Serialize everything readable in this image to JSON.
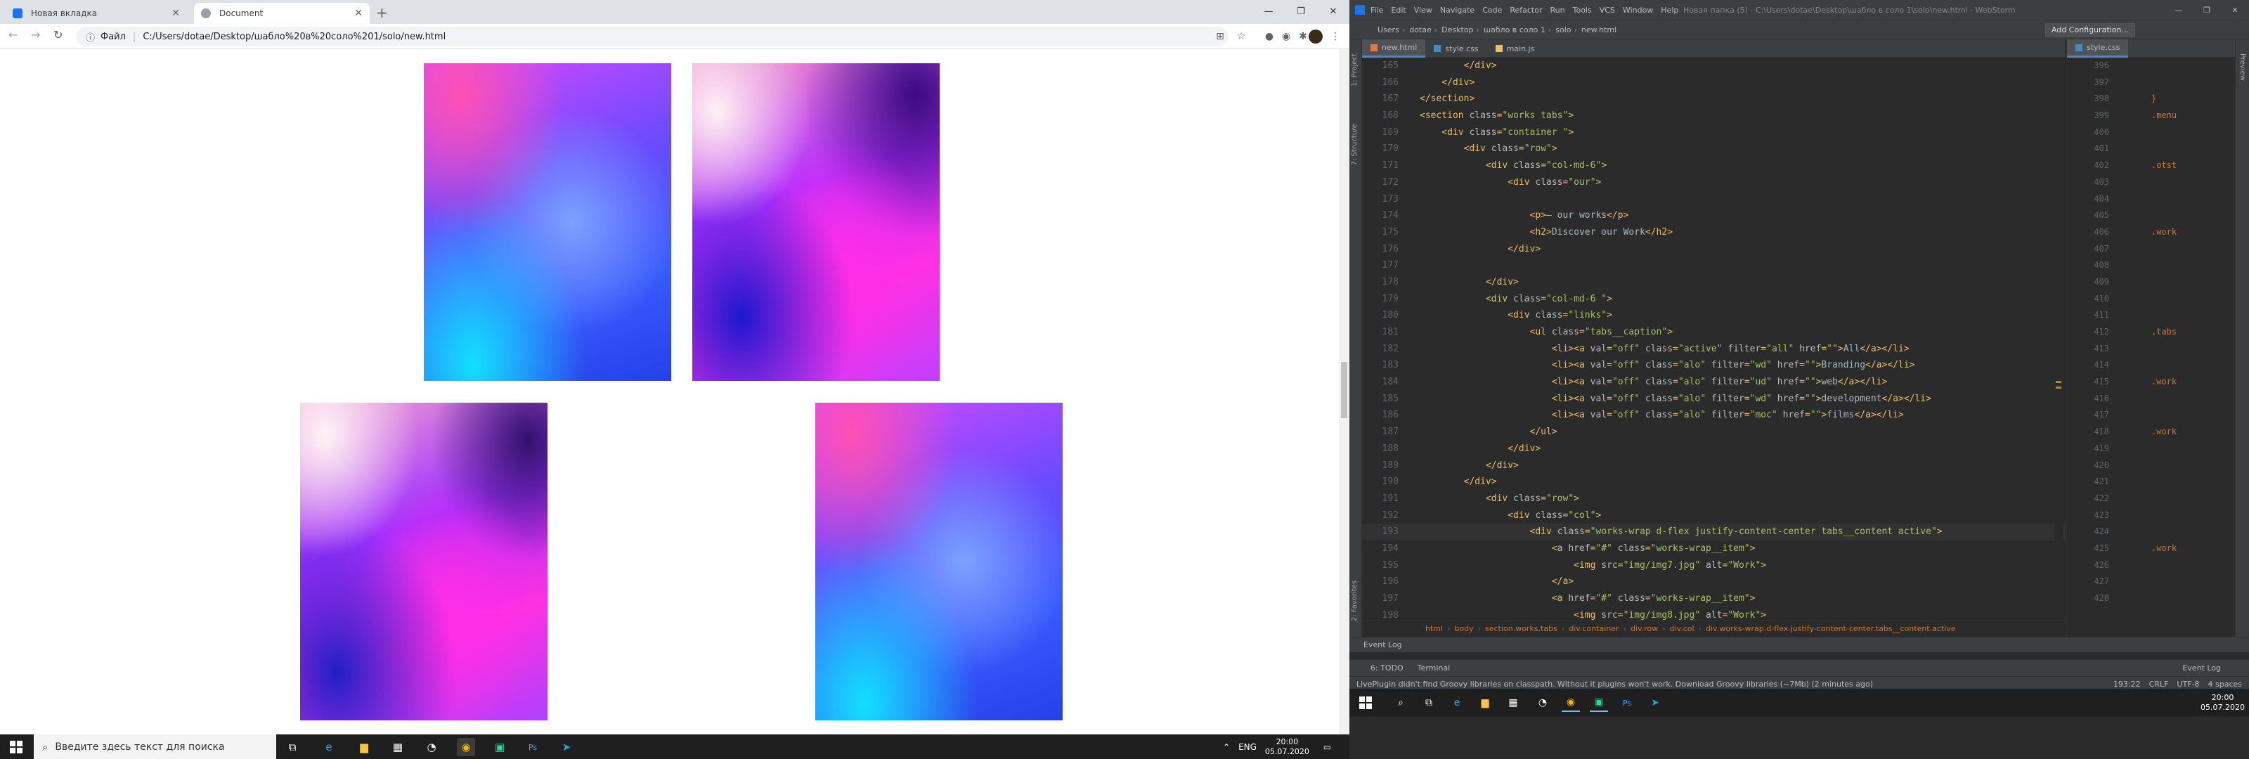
{
  "browser": {
    "tabs": [
      {
        "title": "Новая вкладка"
      },
      {
        "title": "Document"
      }
    ],
    "address": {
      "scheme_label": "Файл",
      "url": "C:/Users/dotae/Desktop/шабло%20в%20соло%201/solo/new.html"
    }
  },
  "taskbar_left": {
    "search_placeholder": "Введите здесь текст для поиска",
    "lang": "ENG",
    "time": "20:00",
    "date": "05.07.2020"
  },
  "ide": {
    "menu": [
      "File",
      "Edit",
      "View",
      "Navigate",
      "Code",
      "Refactor",
      "Run",
      "Tools",
      "VCS",
      "Window",
      "Help"
    ],
    "window_title": "Новая папка (5) - C:\\Users\\dotae\\Desktop\\шабло в соло 1\\solo\\new.html - WebStorm",
    "breadcrumbs": [
      "Users",
      "dotae",
      "Desktop",
      "шабло в соло 1",
      "solo",
      "new.html"
    ],
    "add_config": "Add Configuration...",
    "tool_left": [
      "1: Project",
      "7: Structure",
      "2: Favorites"
    ],
    "editor_tabs": [
      {
        "label": "new.html",
        "color": "#e8754a"
      },
      {
        "label": "style.css",
        "color": "#4a88c7"
      },
      {
        "label": "main.js",
        "color": "#e8bf6a"
      }
    ],
    "right_tab": "style.css",
    "lines": [
      {
        "n": "165",
        "code": "        </div>"
      },
      {
        "n": "166",
        "code": "    </div>"
      },
      {
        "n": "167",
        "code": "</section>"
      },
      {
        "n": "168",
        "code": "<section class=\"works tabs\">"
      },
      {
        "n": "169",
        "code": "    <div class=\"container \">"
      },
      {
        "n": "170",
        "code": "        <div class=\"row\">"
      },
      {
        "n": "171",
        "code": "            <div class=\"col-md-6\">"
      },
      {
        "n": "172",
        "code": "                <div class=\"our\">"
      },
      {
        "n": "173",
        "code": ""
      },
      {
        "n": "174",
        "code": "                    <p>— our works</p>"
      },
      {
        "n": "175",
        "code": "                    <h2>Discover our Work</h2>"
      },
      {
        "n": "176",
        "code": "                </div>"
      },
      {
        "n": "177",
        "code": ""
      },
      {
        "n": "178",
        "code": "            </div>"
      },
      {
        "n": "179",
        "code": "            <div class=\"col-md-6 \">"
      },
      {
        "n": "180",
        "code": "                <div class=\"links\">"
      },
      {
        "n": "181",
        "code": "                    <ul class=\"tabs__caption\">"
      },
      {
        "n": "182",
        "code": "                        <li><a val=\"off\" class=\"active\" filter=\"all\" href=\"\">All</a></li>"
      },
      {
        "n": "183",
        "code": "                        <li><a val=\"off\" class=\"alo\" filter=\"wd\" href=\"\">Branding</a></li>"
      },
      {
        "n": "184",
        "code": "                        <li><a val=\"off\" class=\"alo\" filter=\"ud\" href=\"\">web</a></li>"
      },
      {
        "n": "185",
        "code": "                        <li><a val=\"off\" class=\"alo\" filter=\"wd\" href=\"\">development</a></li>"
      },
      {
        "n": "186",
        "code": "                        <li><a val=\"off\" class=\"alo\" filter=\"moc\" href=\"\">films</a></li>"
      },
      {
        "n": "187",
        "code": "                    </ul>"
      },
      {
        "n": "188",
        "code": "                </div>"
      },
      {
        "n": "189",
        "code": "            </div>"
      },
      {
        "n": "190",
        "code": "        </div>"
      },
      {
        "n": "191",
        "code": "            <div class=\"row\">"
      },
      {
        "n": "192",
        "code": "                <div class=\"col\">"
      },
      {
        "n": "193",
        "code": "                    <div class=\"works-wrap d-flex justify-content-center tabs__content active\">"
      },
      {
        "n": "194",
        "code": "                        <a href=\"#\" class=\"works-wrap__item\">"
      },
      {
        "n": "195",
        "code": "                            <img src=\"img/img7.jpg\" alt=\"Work\">"
      },
      {
        "n": "196",
        "code": "                        </a>"
      },
      {
        "n": "197",
        "code": "                        <a href=\"#\" class=\"works-wrap__item\">"
      },
      {
        "n": "198",
        "code": "                            <img src=\"img/img8.jpg\" alt=\"Work\">"
      }
    ],
    "right_lines": [
      {
        "n": "396",
        "t": ""
      },
      {
        "n": "397",
        "t": ""
      },
      {
        "n": "398",
        "t": "}"
      },
      {
        "n": "399",
        "t": ".menu"
      },
      {
        "n": "400",
        "t": ""
      },
      {
        "n": "401",
        "t": ""
      },
      {
        "n": "402",
        "t": ".otst"
      },
      {
        "n": "403",
        "t": ""
      },
      {
        "n": "404",
        "t": ""
      },
      {
        "n": "405",
        "t": ""
      },
      {
        "n": "406",
        "t": ".work"
      },
      {
        "n": "407",
        "t": ""
      },
      {
        "n": "408",
        "t": ""
      },
      {
        "n": "409",
        "t": ""
      },
      {
        "n": "410",
        "t": ""
      },
      {
        "n": "411",
        "t": ""
      },
      {
        "n": "412",
        "t": ".tabs"
      },
      {
        "n": "413",
        "t": ""
      },
      {
        "n": "414",
        "t": ""
      },
      {
        "n": "415",
        "t": ".work"
      },
      {
        "n": "416",
        "t": ""
      },
      {
        "n": "417",
        "t": ""
      },
      {
        "n": "418",
        "t": ".work"
      },
      {
        "n": "419",
        "t": ""
      },
      {
        "n": "420",
        "t": ""
      },
      {
        "n": "421",
        "t": ""
      },
      {
        "n": "422",
        "t": ""
      },
      {
        "n": "423",
        "t": ""
      },
      {
        "n": "424",
        "t": ""
      },
      {
        "n": "425",
        "t": ".work"
      },
      {
        "n": "426",
        "t": ""
      },
      {
        "n": "427",
        "t": ""
      },
      {
        "n": "428",
        "t": ""
      }
    ],
    "code_breadcrumb": [
      "html",
      "body",
      "section.works.tabs",
      "div.container",
      "div.row",
      "div.col",
      "div.works-wrap.d-flex.justify-content-center.tabs__content.active"
    ],
    "event_log": "Event Log",
    "bottom_tools": [
      "6: TODO",
      "Terminal"
    ],
    "bottom_right_tool": "Event Log",
    "status_msg": "LivePlugin didn't find Groovy libraries on classpath. Without it plugins won't work. Download Groovy libraries (~7Mb) (2 minutes ago)",
    "status_right": [
      "193:22",
      "CRLF",
      "UTF-8",
      "4 spaces"
    ]
  },
  "taskbar_right": {
    "time": "20:00",
    "date": "05.07.2020"
  }
}
